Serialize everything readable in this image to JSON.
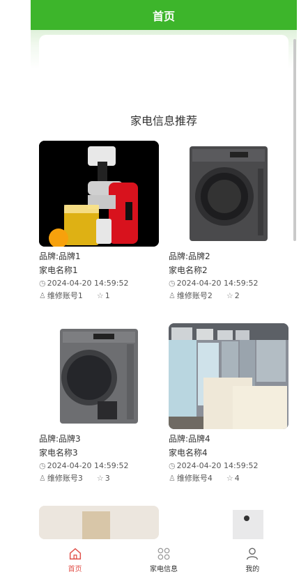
{
  "header": {
    "title": "首页"
  },
  "section": {
    "title": "家电信息推荐"
  },
  "cards": [
    {
      "brand": "品牌:品牌1",
      "name": "家电名称1",
      "time": "2024-04-20 14:59:52",
      "account": "维修账号1",
      "likes": "1",
      "image": "juicer"
    },
    {
      "brand": "品牌:品牌2",
      "name": "家电名称2",
      "time": "2024-04-20 14:59:52",
      "account": "维修账号2",
      "likes": "2",
      "image": "washer-dark"
    },
    {
      "brand": "品牌:品牌3",
      "name": "家电名称3",
      "time": "2024-04-20 14:59:52",
      "account": "维修账号3",
      "likes": "3",
      "image": "dryer"
    },
    {
      "brand": "品牌:品牌4",
      "name": "家电名称4",
      "time": "2024-04-20 14:59:52",
      "account": "维修账号4",
      "likes": "4",
      "image": "appliance-store"
    }
  ],
  "tabbar": [
    {
      "label": "首页",
      "icon": "home-icon",
      "active": true
    },
    {
      "label": "家电信息",
      "icon": "grid-icon",
      "active": false
    },
    {
      "label": "我的",
      "icon": "user-icon",
      "active": false
    }
  ],
  "colors": {
    "primary": "#3db52b",
    "tab_active": "#e0504a"
  }
}
